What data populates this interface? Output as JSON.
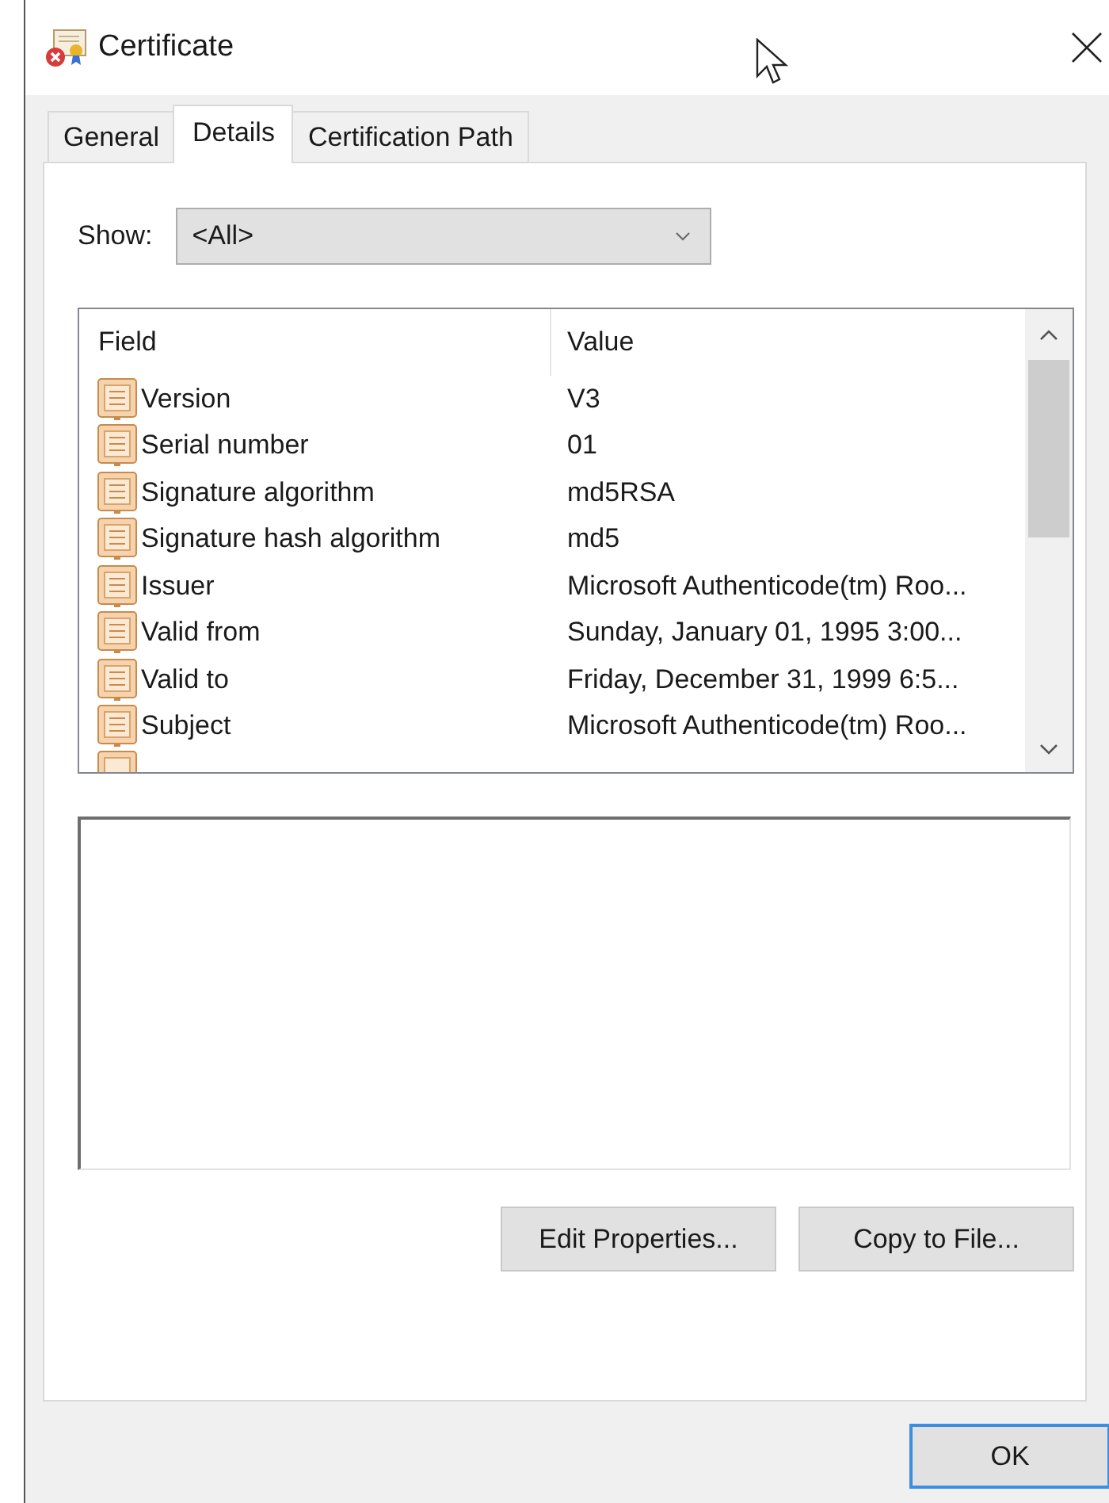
{
  "window": {
    "title": "Certificate"
  },
  "tabs": [
    {
      "label": "General",
      "selected": false
    },
    {
      "label": "Details",
      "selected": true
    },
    {
      "label": "Certification Path",
      "selected": false
    }
  ],
  "show": {
    "label": "Show:",
    "value": "<All>"
  },
  "table": {
    "columns": [
      "Field",
      "Value"
    ],
    "rows": [
      {
        "field": "Version",
        "value": "V3"
      },
      {
        "field": "Serial number",
        "value": "01"
      },
      {
        "field": "Signature algorithm",
        "value": "md5RSA"
      },
      {
        "field": "Signature hash algorithm",
        "value": "md5"
      },
      {
        "field": "Issuer",
        "value": "Microsoft Authenticode(tm) Roo..."
      },
      {
        "field": "Valid from",
        "value": "Sunday, January 01, 1995 3:00..."
      },
      {
        "field": "Valid to",
        "value": "Friday, December 31, 1999 6:5..."
      },
      {
        "field": "Subject",
        "value": "Microsoft Authenticode(tm) Roo..."
      }
    ]
  },
  "buttons": [
    "Edit Properties...",
    "Copy to File..."
  ],
  "ok_button": "OK"
}
